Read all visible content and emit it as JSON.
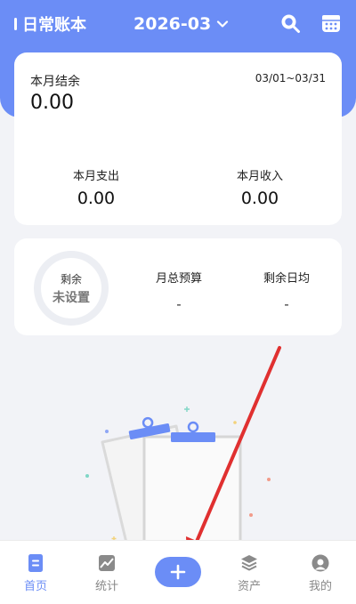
{
  "header": {
    "app_title": "日常账本",
    "month": "2026-03",
    "accent_color": "#6b8df6"
  },
  "summary": {
    "balance_label": "本月结余",
    "balance_value": "0.00",
    "date_range": "03/01~03/31",
    "expense_label": "本月支出",
    "expense_value": "0.00",
    "income_label": "本月收入",
    "income_value": "0.00"
  },
  "budget": {
    "ring_label": "剩余",
    "ring_status": "未设置",
    "total_label": "月总预算",
    "total_value": "-",
    "daily_label": "剩余日均",
    "daily_value": "-"
  },
  "tabbar": {
    "items": [
      {
        "label": "首页",
        "icon": "home-doc-icon",
        "active": true
      },
      {
        "label": "统计",
        "icon": "chart-icon",
        "active": false
      },
      {
        "label": "资产",
        "icon": "layers-icon",
        "active": false
      },
      {
        "label": "我的",
        "icon": "profile-icon",
        "active": false
      }
    ],
    "add_icon": "plus-icon"
  }
}
